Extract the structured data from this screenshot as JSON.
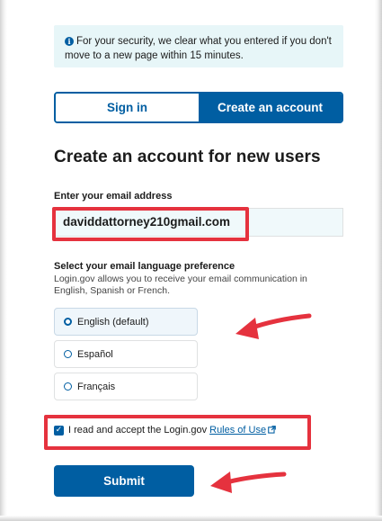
{
  "notice": {
    "icon": "info-icon",
    "text": "For your security, we clear what you entered if you don't move to a new page within 15 minutes."
  },
  "tabs": [
    {
      "label": "Sign in",
      "active": false
    },
    {
      "label": "Create an account",
      "active": true
    }
  ],
  "page_title": "Create an account for new users",
  "email": {
    "label": "Enter your email address",
    "value": "daviddattorney210gmail.com"
  },
  "language": {
    "label": "Select your email language preference",
    "hint": "Login.gov allows you to receive your email communication in English, Spanish or French.",
    "options": [
      {
        "label": "English (default)",
        "selected": true
      },
      {
        "label": "Español",
        "selected": false
      },
      {
        "label": "Français",
        "selected": false
      }
    ]
  },
  "terms": {
    "checked": true,
    "text": "I read and accept the Login.gov",
    "link": "Rules of Use",
    "link_icon": "external-link-icon"
  },
  "submit_label": "Submit",
  "colors": {
    "primary": "#005ea2",
    "annotation": "#e5323e",
    "notice_bg": "#e7f6f8"
  }
}
